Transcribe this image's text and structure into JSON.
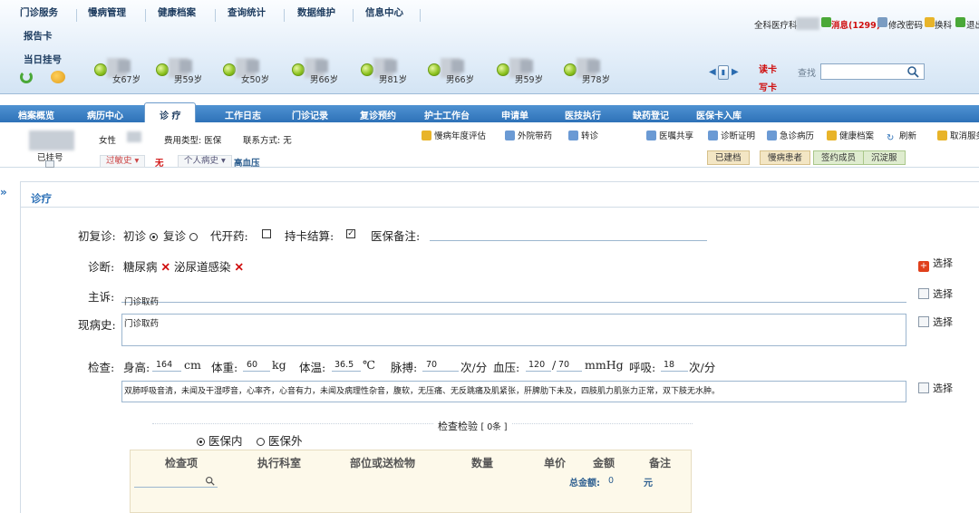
{
  "menu": {
    "items": [
      "门诊服务",
      "慢病管理",
      "健康档案",
      "查询统计",
      "数据维护",
      "信息中心"
    ],
    "report": "报告卡",
    "today": "当日挂号"
  },
  "patients": [
    {
      "age": "女67岁"
    },
    {
      "age": "男59岁"
    },
    {
      "age": "女50岁"
    },
    {
      "age": "男66岁"
    },
    {
      "age": "男81岁"
    },
    {
      "age": "男66岁"
    },
    {
      "age": "男59岁"
    },
    {
      "age": "男78岁"
    }
  ],
  "topright": {
    "dept": "全科医疗科",
    "message": "消息(1299)",
    "change_password": "修改密码",
    "switch_dept": "换科",
    "exit": "退出"
  },
  "card": {
    "read": "读卡",
    "write": "写卡"
  },
  "search": {
    "label": "查找",
    "value": ""
  },
  "nav": {
    "items": [
      "档案概览",
      "病历中心",
      "诊 疗",
      "工作日志",
      "门诊记录",
      "复诊预约",
      "护士工作台",
      "申请单",
      "医技执行",
      "缺药登记",
      "医保卡入库"
    ],
    "active_index": 2
  },
  "patient_info": {
    "gender": "女性",
    "fee_type": "费用类型: 医保",
    "contact": "联系方式: 无",
    "status": "已挂号",
    "allergy_label": "过敏史",
    "allergy_value": "无",
    "history_label": "个人病史",
    "history_value": "高血压"
  },
  "toolbar": {
    "items": [
      "慢病年度评估",
      "外院带药",
      "转诊",
      "医嘱共享",
      "诊断证明",
      "急诊病历",
      "健康档案",
      "刷新",
      "取消服务"
    ]
  },
  "crumbs": [
    "已建档",
    "慢病患者",
    "签约成员",
    "沉淀服"
  ],
  "section": {
    "title": "诊疗"
  },
  "form": {
    "visit_label": "初复诊:",
    "first_visit": "初诊",
    "revisit": "复诊",
    "proxy_label": "代开药:",
    "card_settle_label": "持卡结算:",
    "insurance_note_label": "医保备注:",
    "diagnosis_label": "诊断:",
    "diagnoses": [
      "糖尿病",
      "泌尿道感染"
    ],
    "select": "选择",
    "complaint_label": "主诉:",
    "complaint": "门诊取药",
    "history_label": "现病史:",
    "history": "门诊取药",
    "exam_label": "检查:",
    "height_label": "身高:",
    "height": "164",
    "height_unit": "cm",
    "weight_label": "体重:",
    "weight": "60",
    "weight_unit": "kg",
    "temp_label": "体温:",
    "temp": "36.5",
    "temp_unit": "℃",
    "pulse_label": "脉搏:",
    "pulse": "70",
    "pulse_unit": "次/分",
    "bp_label": "血压:",
    "bp_sys": "120",
    "bp_sep": "/",
    "bp_dia": "70",
    "bp_unit": "mmHg",
    "resp_label": "呼吸:",
    "resp": "18",
    "resp_unit": "次/分",
    "exam_text": "双肺呼吸音清，未闻及干湿啰音，心率齐，心音有力，未闻及病理性杂音，腹软，无压痛、无反跳痛及肌紧张，肝脾肋下未及，四肢肌力肌张力正常，双下肢无水肿。"
  },
  "lab": {
    "title": "检查检验",
    "count": "[ 0条 ]",
    "in_insurance": "医保内",
    "out_insurance": "医保外",
    "columns": [
      "检查项",
      "执行科室",
      "部位或送检物",
      "数量",
      "单价",
      "金额",
      "备注"
    ],
    "total_label": "总金额:",
    "total_value": "0",
    "total_unit": "元"
  }
}
